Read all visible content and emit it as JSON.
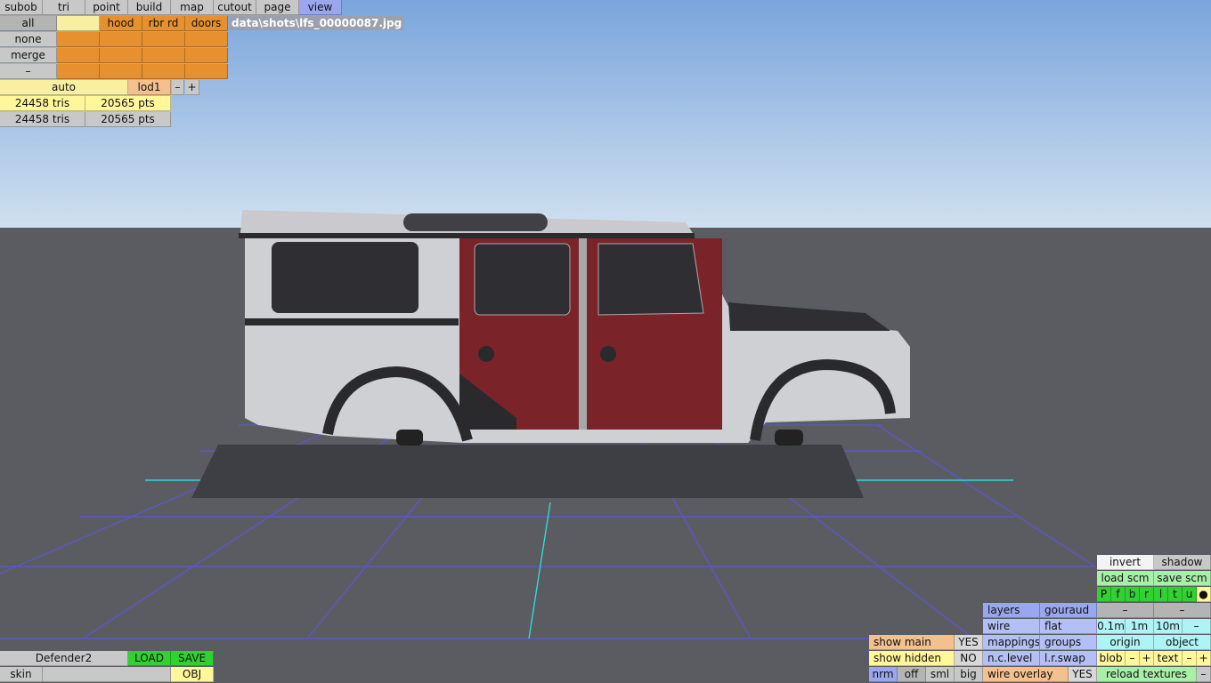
{
  "menu": [
    "subob",
    "tri",
    "point",
    "build",
    "map",
    "cutout",
    "page",
    "view"
  ],
  "groups": {
    "row1": [
      "all",
      "",
      "hood",
      "rbr rd",
      "doors"
    ],
    "row2": [
      "none"
    ],
    "row3": [
      "merge"
    ],
    "row4": [
      "–"
    ]
  },
  "file_path": "data\\shots\\lfs_00000087.jpg",
  "lod": {
    "mode": "auto",
    "level": "lod1",
    "minus": "–",
    "plus": "+"
  },
  "stats": [
    {
      "tris": "24458 tris",
      "pts": "20565 pts"
    },
    {
      "tris": "24458 tris",
      "pts": "20565 pts"
    }
  ],
  "bottom_left": {
    "name": "Defender2",
    "load": "LOAD",
    "save": "SAVE",
    "skin": "skin",
    "format": "OBJ"
  },
  "show": {
    "main": "show main",
    "main_val": "YES",
    "hidden": "show hidden",
    "hidden_val": "NO"
  },
  "view_sizes": [
    "nrm",
    "off",
    "sml",
    "big"
  ],
  "wire_overlay": {
    "label": "wire overlay",
    "value": "YES"
  },
  "render": {
    "layers": "layers",
    "gouraud": "gouraud",
    "wire": "wire",
    "flat": "flat",
    "mappings": "mappings",
    "groups": "groups",
    "nc_level": "n.c.level",
    "lr_swap": "l.r.swap"
  },
  "right_panel": {
    "invert": "invert",
    "shadow": "shadow",
    "load_scm": "load scm",
    "save_scm": "save scm",
    "letters": [
      "P",
      "f",
      "b",
      "r",
      "l",
      "t",
      "u",
      "●"
    ],
    "dash1": "–",
    "dash2": "–",
    "scales": [
      "0.1m",
      "1m",
      "10m",
      "–"
    ],
    "origin": "origin",
    "object": "object",
    "blob": "blob",
    "text": "text",
    "minus": "–",
    "plus": "+",
    "reload": "reload textures",
    "last": "–"
  }
}
